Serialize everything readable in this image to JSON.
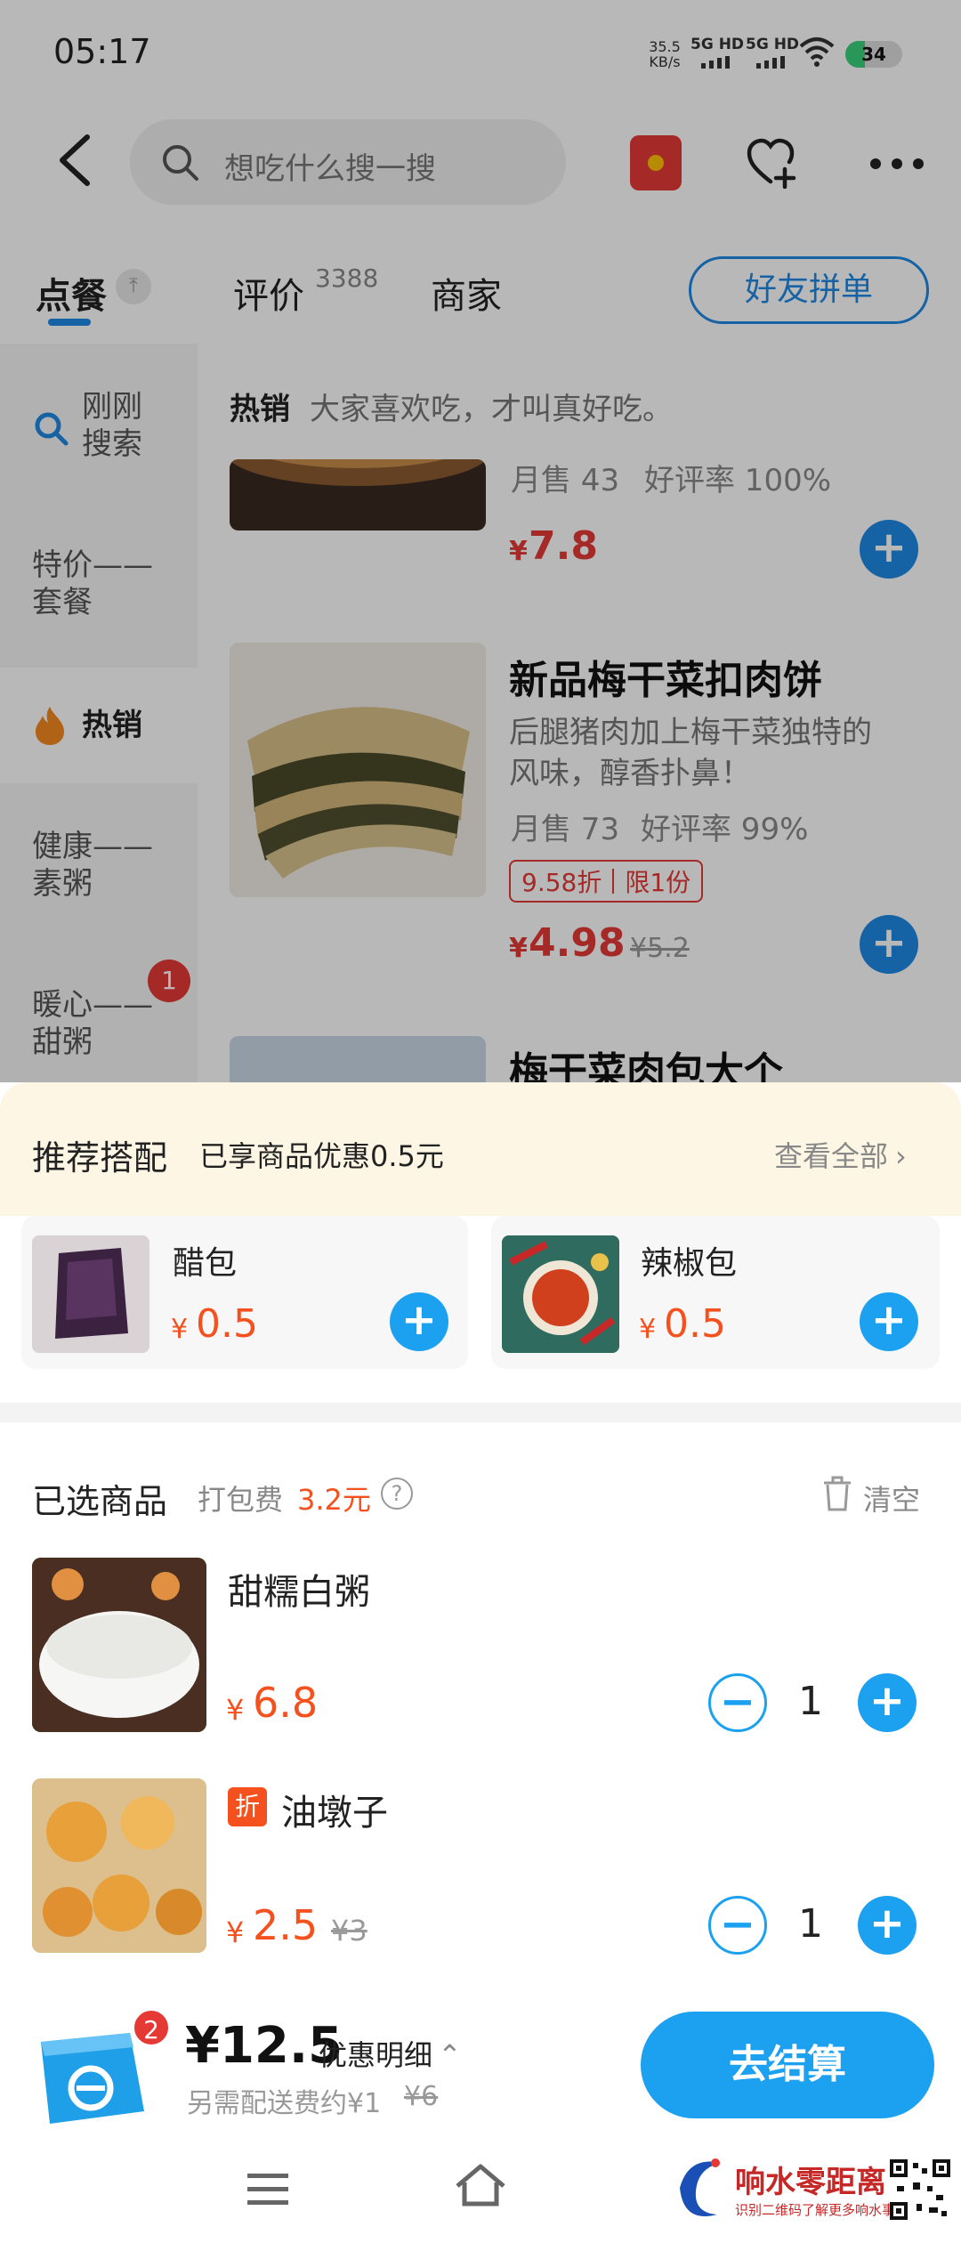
{
  "status_bar": {
    "time": "05:17",
    "speed": "35.5",
    "speed_unit": "KB/s",
    "net1": "5G HD",
    "net2": "5G HD",
    "battery": "34"
  },
  "header": {
    "search_placeholder": "想吃什么搜一搜"
  },
  "tabs": {
    "order": "点餐",
    "reviews": "评价",
    "review_count": "3388",
    "merchant": "商家",
    "friend_order": "好友拼单"
  },
  "sidebar": {
    "just_searched": "刚刚\n搜索",
    "items": [
      "特价——\n套餐",
      "热销",
      "健康——\n素粥",
      "暖心——\n甜粥"
    ],
    "badge": "1"
  },
  "section": {
    "title": "热销",
    "subtitle": "大家喜欢吃，才叫真好吃。"
  },
  "products": [
    {
      "sales": "月售 43",
      "rating": "好评率 100%",
      "price_symbol": "¥",
      "price": "7.8"
    },
    {
      "name": "新品梅干菜扣肉饼",
      "desc": "后腿猪肉加上梅干菜独特的\n风味，醇香扑鼻！",
      "sales": "月售 73",
      "rating": "好评率 99%",
      "discount": "9.58折",
      "limit": "限1份",
      "price_symbol": "¥",
      "price": "4.98",
      "orig_price": "¥5.2"
    },
    {
      "name": "梅干菜肉包大个"
    }
  ],
  "recommend": {
    "title": "推荐搭配",
    "subtitle": "已享商品优惠0.5元",
    "view_all": "查看全部",
    "items": [
      {
        "name": "醋包",
        "price_symbol": "¥",
        "price": "0.5"
      },
      {
        "name": "辣椒包",
        "price_symbol": "¥",
        "price": "0.5"
      }
    ]
  },
  "cart": {
    "title": "已选商品",
    "packing_label": "打包费",
    "packing_fee": "3.2元",
    "clear": "清空",
    "items": [
      {
        "name": "甜糯白粥",
        "price_symbol": "¥",
        "price": "6.8",
        "qty": "1"
      },
      {
        "tag": "折",
        "name": "油墩子",
        "price_symbol": "¥",
        "price": "2.5",
        "orig_price": "¥3",
        "qty": "1"
      }
    ]
  },
  "checkout": {
    "badge": "2",
    "total": "¥12.5",
    "discount_detail": "优惠明细",
    "delivery_note": "另需配送费约¥1",
    "delivery_orig": "¥6",
    "button": "去结算"
  },
  "watermark": {
    "brand": "响水零距离",
    "tagline": "识别二维码了解更多响水事"
  },
  "colors": {
    "accent": "#1e88e5",
    "price": "#e53935",
    "rec_bg": "#fdf6e4"
  }
}
